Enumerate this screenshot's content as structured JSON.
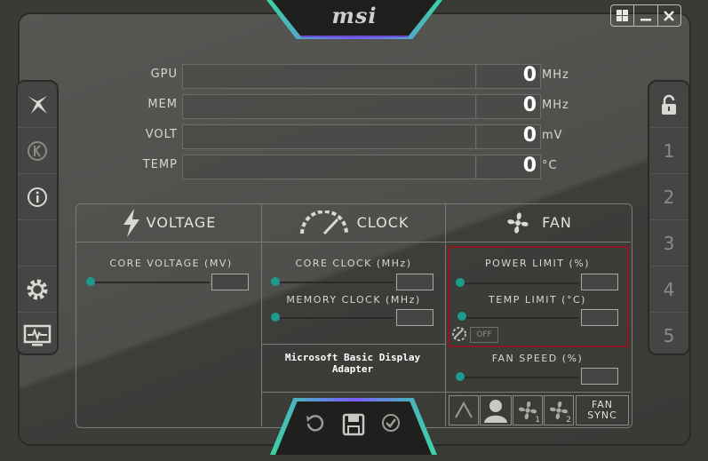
{
  "header": {
    "logo": "msi"
  },
  "window_controls": [
    "windows-icon",
    "minimize-icon",
    "close-icon"
  ],
  "meters": [
    {
      "label": "GPU",
      "value": "0",
      "unit": "MHz"
    },
    {
      "label": "MEM",
      "value": "0",
      "unit": "MHz"
    },
    {
      "label": "VOLT",
      "value": "0",
      "unit": "mV"
    },
    {
      "label": "TEMP",
      "value": "0",
      "unit": "°C"
    }
  ],
  "left_sidebar": [
    "kombustor-icon",
    "k-icon",
    "info-icon",
    "settings-icon",
    "monitor-icon"
  ],
  "right_sidebar": {
    "lock": "lock-icon",
    "profiles": [
      "1",
      "2",
      "3",
      "4",
      "5"
    ]
  },
  "sections": {
    "voltage": {
      "title": "VOLTAGE",
      "core_voltage_label": "CORE VOLTAGE (MV)"
    },
    "clock": {
      "title": "CLOCK",
      "core_clock_label": "CORE CLOCK (MHz)",
      "memory_clock_label": "MEMORY CLOCK (MHz)",
      "adapter": "Microsoft Basic Display Adapter"
    },
    "fan": {
      "title": "FAN",
      "power_limit_label": "POWER LIMIT (%)",
      "temp_limit_label": "TEMP LIMIT (°C)",
      "link_toggle": "OFF",
      "fan_speed_label": "FAN SPEED (%)",
      "fan_sync_label": "FAN SYNC",
      "fan1_label": "1",
      "fan2_label": "2"
    }
  },
  "colors": {
    "accent_teal": "#1b9a8e",
    "highlight_red": "#8a1a1f",
    "bezel_glow": "#7a5cff"
  }
}
